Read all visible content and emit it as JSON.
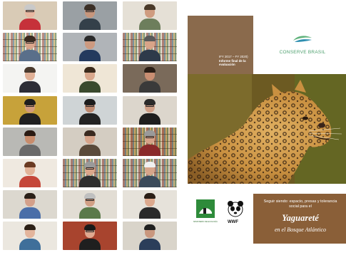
{
  "poster": {
    "evaluation_line1": "IFY 2017 – FY 2020)",
    "evaluation_line2": "Informe final de la evaluación",
    "brand": "CONSERVE BRASIL",
    "subtitle": "Seguir siendo: espacio, presas y tolerancia social para el",
    "title": "Yaguareté",
    "location": "en el Bosque Atlántico",
    "logo_left_caption": "MINISTERIO DE ECOLOGÍA",
    "logo_right": "WWF",
    "colors": {
      "brown": "#8a6a4c",
      "brown_dark": "#8a5f38",
      "green": "#4a9e6b"
    }
  },
  "participants": [
    {
      "wall": "#d9cbb6",
      "skin": "#e8b8a2",
      "hair": "#c9c9c9",
      "shirt": "#c6313a",
      "glasses": true,
      "books": false
    },
    {
      "wall": "#f2eee6",
      "skin": "#d9a58b",
      "hair": "#3a2a20",
      "shirt": "#5a6f8a",
      "glasses": true,
      "books": true
    },
    {
      "wall": "#f4f4f2",
      "skin": "#e0b096",
      "hair": "#4a3a2e",
      "shirt": "#2d2d36",
      "glasses": false,
      "books": false
    },
    {
      "wall": "#c7a23a",
      "skin": "#d49c7c",
      "hair": "#1e1e1e",
      "shirt": "#202020",
      "glasses": true,
      "books": false
    },
    {
      "wall": "#b9b9b5",
      "skin": "#c88c6c",
      "hair": "#2a1a12",
      "shirt": "#6a6a6a",
      "glasses": false,
      "books": false
    },
    {
      "wall": "#efe9e0",
      "skin": "#e2b398",
      "hair": "#6a3a22",
      "shirt": "#c5473a",
      "glasses": false,
      "books": false
    },
    {
      "wall": "#dcd8cf",
      "skin": "#d3a08a",
      "hair": "#2a2018",
      "shirt": "#4a6ea8",
      "glasses": false,
      "books": false
    },
    {
      "wall": "#ebe7df",
      "skin": "#e3b59c",
      "hair": "#2c2016",
      "shirt": "#3f6f9a",
      "glasses": false,
      "books": false
    },
    {
      "wall": "#9aa0a4",
      "skin": "#c7967c",
      "hair": "#3b2f26",
      "shirt": "#34404a",
      "glasses": true,
      "books": false
    },
    {
      "wall": "#b0b4b8",
      "skin": "#cd9a80",
      "hair": "#2a2a2a",
      "shirt": "#243a5e",
      "glasses": false,
      "books": false
    },
    {
      "wall": "#efe6d6",
      "skin": "#d8a78c",
      "hair": "#3a2a1c",
      "shirt": "#3a4a2e",
      "glasses": false,
      "books": false
    },
    {
      "wall": "#cfd4d6",
      "skin": "#bf8a70",
      "hair": "#1c1c1c",
      "shirt": "#232323",
      "glasses": true,
      "books": false
    },
    {
      "wall": "#d4cdc2",
      "skin": "#d6a48a",
      "hair": "#3a2a20",
      "shirt": "#5a4a3a",
      "glasses": false,
      "books": false
    },
    {
      "wall": "#cfcac0",
      "skin": "#dba68a",
      "hair": "#9a9a9a",
      "shirt": "#2e2e2e",
      "glasses": true,
      "books": true
    },
    {
      "wall": "#e2ddd4",
      "skin": "#d2a086",
      "hair": "#bfbfbf",
      "shirt": "#5a7a4a",
      "glasses": true,
      "books": false
    },
    {
      "wall": "#a8442e",
      "skin": "#e0a990",
      "hair": "#1a1a1a",
      "shirt": "#1f1f1f",
      "glasses": true,
      "books": false
    },
    {
      "wall": "#e5e0d6",
      "skin": "#cf9c80",
      "hair": "#4a3a2a",
      "shirt": "#6d7e5c",
      "glasses": false,
      "books": false
    },
    {
      "wall": "#d8d3c9",
      "skin": "#d8a488",
      "hair": "#5a5a5a",
      "shirt": "#2e3a4a",
      "glasses": false,
      "books": true
    },
    {
      "wall": "#7a6a5a",
      "skin": "#c98e72",
      "hair": "#2a1e16",
      "shirt": "#3a3a3a",
      "glasses": false,
      "books": false
    },
    {
      "wall": "#dcd6cc",
      "skin": "#d0a088",
      "hair": "#2a2a2a",
      "shirt": "#1e1e1e",
      "glasses": true,
      "books": false
    },
    {
      "wall": "#c9a47a",
      "skin": "#d6a288",
      "hair": "#9a9a9a",
      "shirt": "#8a2a2a",
      "glasses": true,
      "books": true
    },
    {
      "wall": "#c9c3b8",
      "skin": "#d7a58a",
      "hair": "#f0f0f0",
      "shirt": "#3a4a5a",
      "glasses": false,
      "books": true
    },
    {
      "wall": "#e6e2da",
      "skin": "#dca98e",
      "hair": "#2a1e16",
      "shirt": "#2a2a2a",
      "glasses": false,
      "books": false
    },
    {
      "wall": "#d9d4ca",
      "skin": "#c9977e",
      "hair": "#202020",
      "shirt": "#2b3e5a",
      "glasses": false,
      "books": false
    }
  ]
}
